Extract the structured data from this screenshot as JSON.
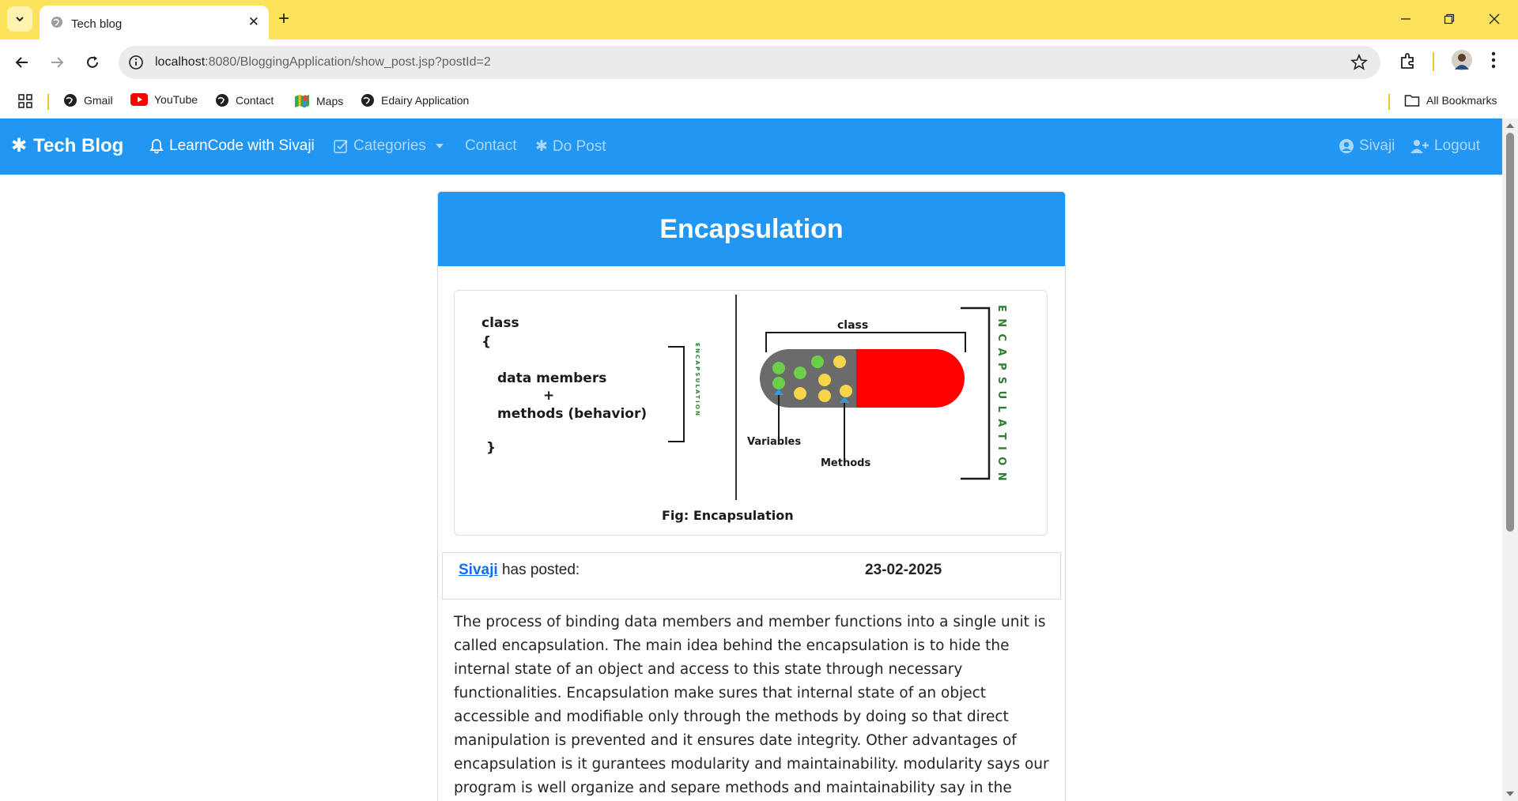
{
  "browser": {
    "tab_title": "Tech blog",
    "url_host": "localhost",
    "url_rest": ":8080/BloggingApplication/show_post.jsp?postId=2",
    "bookmarks": [
      {
        "label": "Gmail",
        "icon": "globe-icon"
      },
      {
        "label": "YouTube",
        "icon": "youtube-icon"
      },
      {
        "label": "Contact",
        "icon": "globe-icon"
      },
      {
        "label": "Maps",
        "icon": "maps-icon"
      },
      {
        "label": "Edairy Application",
        "icon": "globe-icon"
      }
    ],
    "all_bookmarks": "All Bookmarks"
  },
  "navbar": {
    "brand": "Tech Blog",
    "items": [
      {
        "label": "LearnCode with Sivaji",
        "icon": "bell-icon"
      },
      {
        "label": "Categories",
        "icon": "check-square-icon"
      },
      {
        "label": "Contact"
      },
      {
        "label": "Do Post",
        "icon": "asterisk-icon"
      }
    ],
    "user": {
      "label": "Sivaji",
      "icon": "user-circle-icon"
    },
    "logout": {
      "label": "Logout",
      "icon": "user-plus-icon"
    },
    "color": "#2196f3"
  },
  "post": {
    "title": "Encapsulation",
    "figure": {
      "left_code": [
        "class",
        "{",
        "data members",
        "+",
        "methods (behavior)",
        "}"
      ],
      "side_label": "ENCAPSULATION",
      "class_label": "class",
      "variables_label": "Variables",
      "methods_label": "Methods",
      "caption": "Fig: Encapsulation"
    },
    "author": "Sivaji",
    "posted_text": "has posted:",
    "date": "23-02-2025",
    "content": "The process of binding data members and member functions into a single unit is called encapsulation. The main idea behind the encapsulation is to hide the internal state of an object and access to this state through necessary functionalities. Encapsulation make sures that internal state of an object accessible and modifiable only through the methods by doing so that direct manipulation is prevented and it ensures date integrity. Other advantages of encapsulation is it gurantees modularity and maintainability. modularity says our program is well organize and separe methods and maintainability say in the future program gets updated changes can"
  }
}
